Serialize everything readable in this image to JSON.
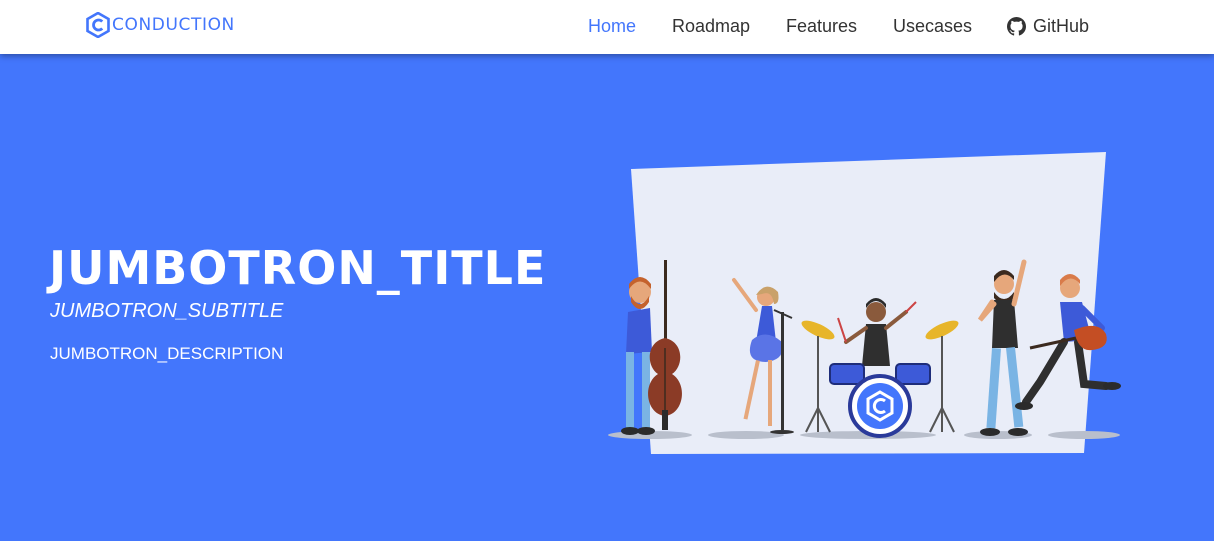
{
  "brand": {
    "name": "CONDUCTION",
    "logo_icon": "conduction-hexagon-c-icon",
    "color": "#4376fc"
  },
  "nav": {
    "items": [
      {
        "label": "Home",
        "active": true
      },
      {
        "label": "Roadmap",
        "active": false
      },
      {
        "label": "Features",
        "active": false
      },
      {
        "label": "Usecases",
        "active": false
      },
      {
        "label": "GitHub",
        "active": false,
        "icon": "github-icon"
      }
    ]
  },
  "jumbotron": {
    "title": "JUMBOTRON_TITLE",
    "subtitle": "JUMBOTRON_SUBTITLE",
    "description": "JUMBOTRON_DESCRIPTION",
    "background_color": "#4376fc",
    "illustration": "band-performing-illustration"
  }
}
